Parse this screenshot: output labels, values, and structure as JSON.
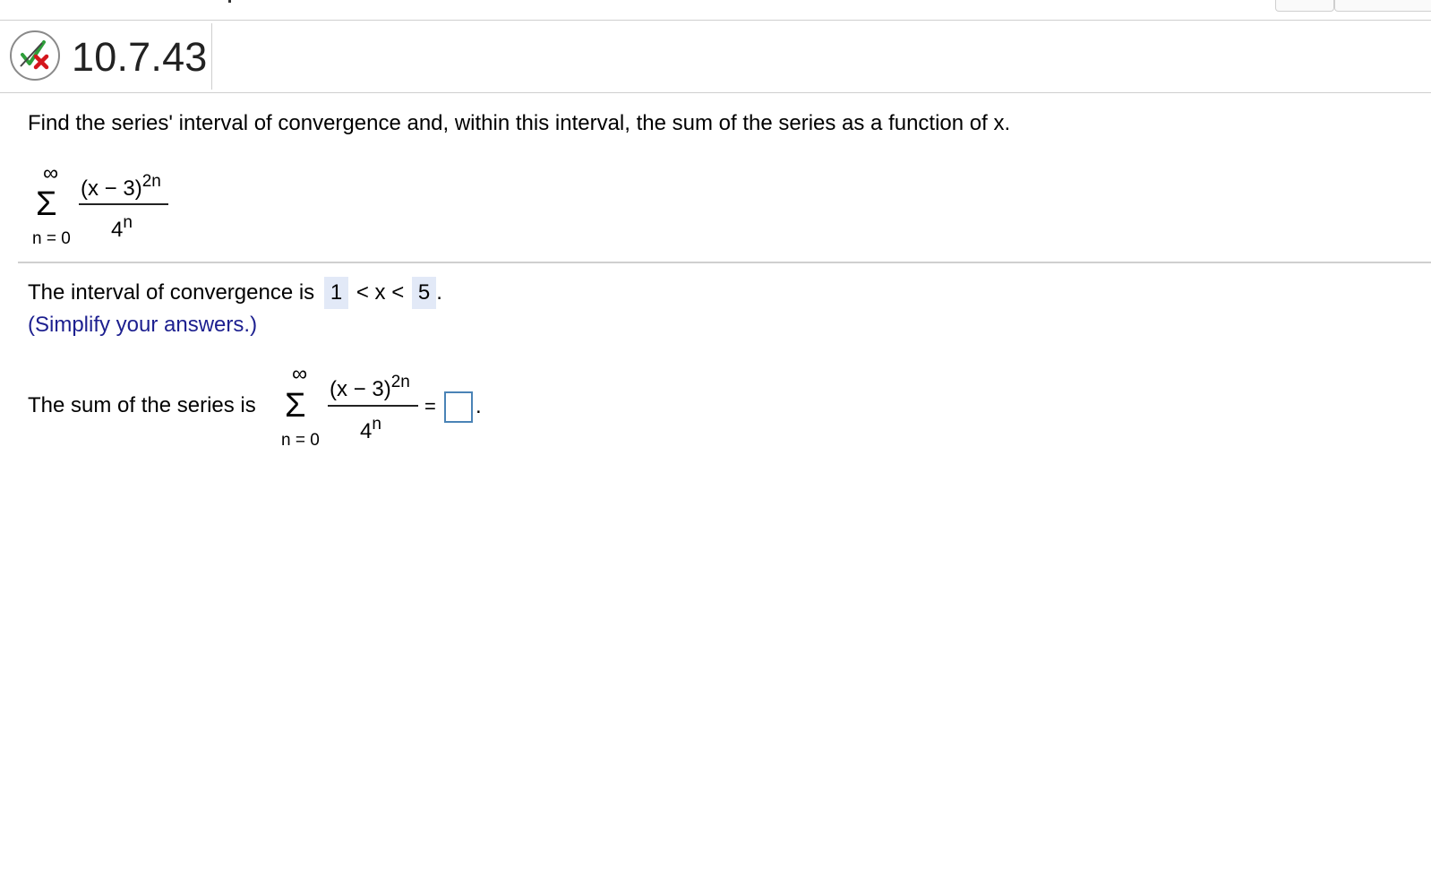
{
  "question": {
    "number": "10.7.43",
    "status_icon": "check-x-icon",
    "prompt": "Find the series' interval of convergence and, within this interval, the sum of the series as a function of x."
  },
  "series": {
    "upper": "∞",
    "sigma": "Σ",
    "lower": "n = 0",
    "numerator_base": "(x − 3)",
    "numerator_exp": "2n",
    "denominator_base": "4",
    "denominator_exp": "n"
  },
  "interval": {
    "prefix": "The interval of convergence is",
    "lower_answer": "1",
    "relation": "< x <",
    "upper_answer": "5",
    "suffix": ".",
    "hint": "(Simplify your answers.)"
  },
  "sum": {
    "prefix": "The sum of the series is",
    "equals": "=",
    "suffix": ".",
    "answer_value": ""
  },
  "colors": {
    "answer_highlight": "#e2e9f7",
    "hint_text": "#1c1f8f",
    "input_border": "#4a83b6",
    "check_green": "#2e9e3a",
    "x_red": "#d4161c"
  }
}
